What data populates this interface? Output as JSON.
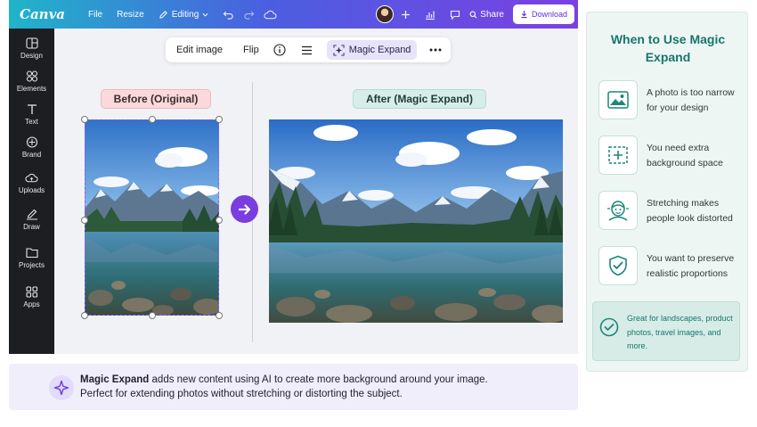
{
  "topbar": {
    "logo": "Canva",
    "file": "File",
    "resize": "Resize",
    "editing": "Editing",
    "share": "Share",
    "download": "Download"
  },
  "sidebar": {
    "items": [
      {
        "label": "Design",
        "icon": "design-icon"
      },
      {
        "label": "Elements",
        "icon": "elements-icon"
      },
      {
        "label": "Text",
        "icon": "text-icon"
      },
      {
        "label": "Brand",
        "icon": "brand-icon"
      },
      {
        "label": "Uploads",
        "icon": "uploads-icon"
      },
      {
        "label": "Draw",
        "icon": "draw-icon"
      },
      {
        "label": "Projects",
        "icon": "folder-icon"
      },
      {
        "label": "Apps",
        "icon": "apps-icon"
      }
    ]
  },
  "toolbar": {
    "edit_image": "Edit image",
    "flip": "Flip",
    "magic_expand": "Magic Expand"
  },
  "canvas": {
    "before_label": "Before (Original)",
    "after_label": "After (Magic Expand)"
  },
  "info": {
    "bold": "Magic Expand",
    "line1": " adds new content using AI to create more background around your image.",
    "line2": "Perfect for extending photos without stretching or distorting the subject."
  },
  "panel": {
    "title": "When to Use Magic Expand",
    "items": [
      {
        "text": "A photo is too narrow for your design",
        "icon": "image-icon"
      },
      {
        "text": "You need extra background space",
        "icon": "expand-frame-icon"
      },
      {
        "text": "Stretching makes people look distorted",
        "icon": "distorted-face-icon"
      },
      {
        "text": "You want to preserve realistic proportions",
        "icon": "shield-check-icon"
      }
    ],
    "note": "Great for landscapes, product photos, travel images, and more."
  },
  "colors": {
    "accent": "#7a3de0",
    "panel_title": "#15776a"
  }
}
